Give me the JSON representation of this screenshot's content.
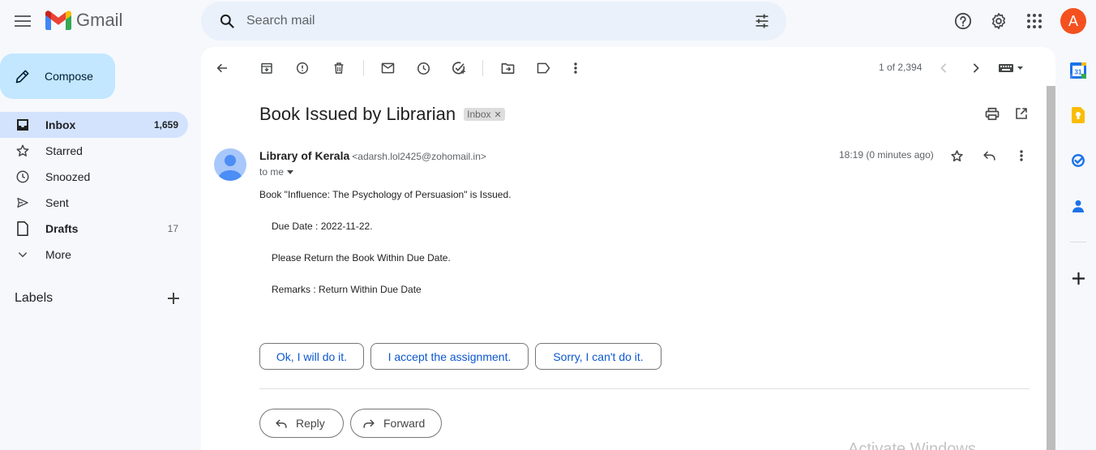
{
  "app": {
    "name": "Gmail"
  },
  "search": {
    "placeholder": "Search mail"
  },
  "account": {
    "initial": "A",
    "color": "#f4511e"
  },
  "compose": {
    "label": "Compose"
  },
  "nav": [
    {
      "label": "Inbox",
      "count": "1,659",
      "icon": "inbox-icon"
    },
    {
      "label": "Starred",
      "count": "",
      "icon": "star-icon"
    },
    {
      "label": "Snoozed",
      "count": "",
      "icon": "clock-icon"
    },
    {
      "label": "Sent",
      "count": "",
      "icon": "send-icon"
    },
    {
      "label": "Drafts",
      "count": "17",
      "icon": "draft-icon"
    },
    {
      "label": "More",
      "count": "",
      "icon": "chevron-down-icon"
    }
  ],
  "labels": {
    "title": "Labels"
  },
  "pager": {
    "text": "1 of 2,394"
  },
  "email": {
    "subject": "Book Issued by Librarian",
    "label_chip": "Inbox",
    "sender_name": "Library of Kerala",
    "sender_email": "<adarsh.lol2425@zohomail.in>",
    "to": "to me",
    "time": "18:19 (0 minutes ago)",
    "body": [
      "Book \"Influence: The Psychology of Persuasion\" is Issued.",
      "Due Date : 2022-11-22.",
      "Please Return the Book Within Due Date.",
      "Remarks : Return Within Due Date"
    ]
  },
  "smart_replies": [
    "Ok, I will do it.",
    "I accept the assignment.",
    "Sorry, I can't do it."
  ],
  "actions": {
    "reply": "Reply",
    "forward": "Forward"
  },
  "watermark": "Activate Windows",
  "colors": {
    "accent": "#0b57d0",
    "compose_bg": "#c2e7ff",
    "active_nav": "#d3e3fd",
    "page_bg": "#f6f8fc"
  }
}
